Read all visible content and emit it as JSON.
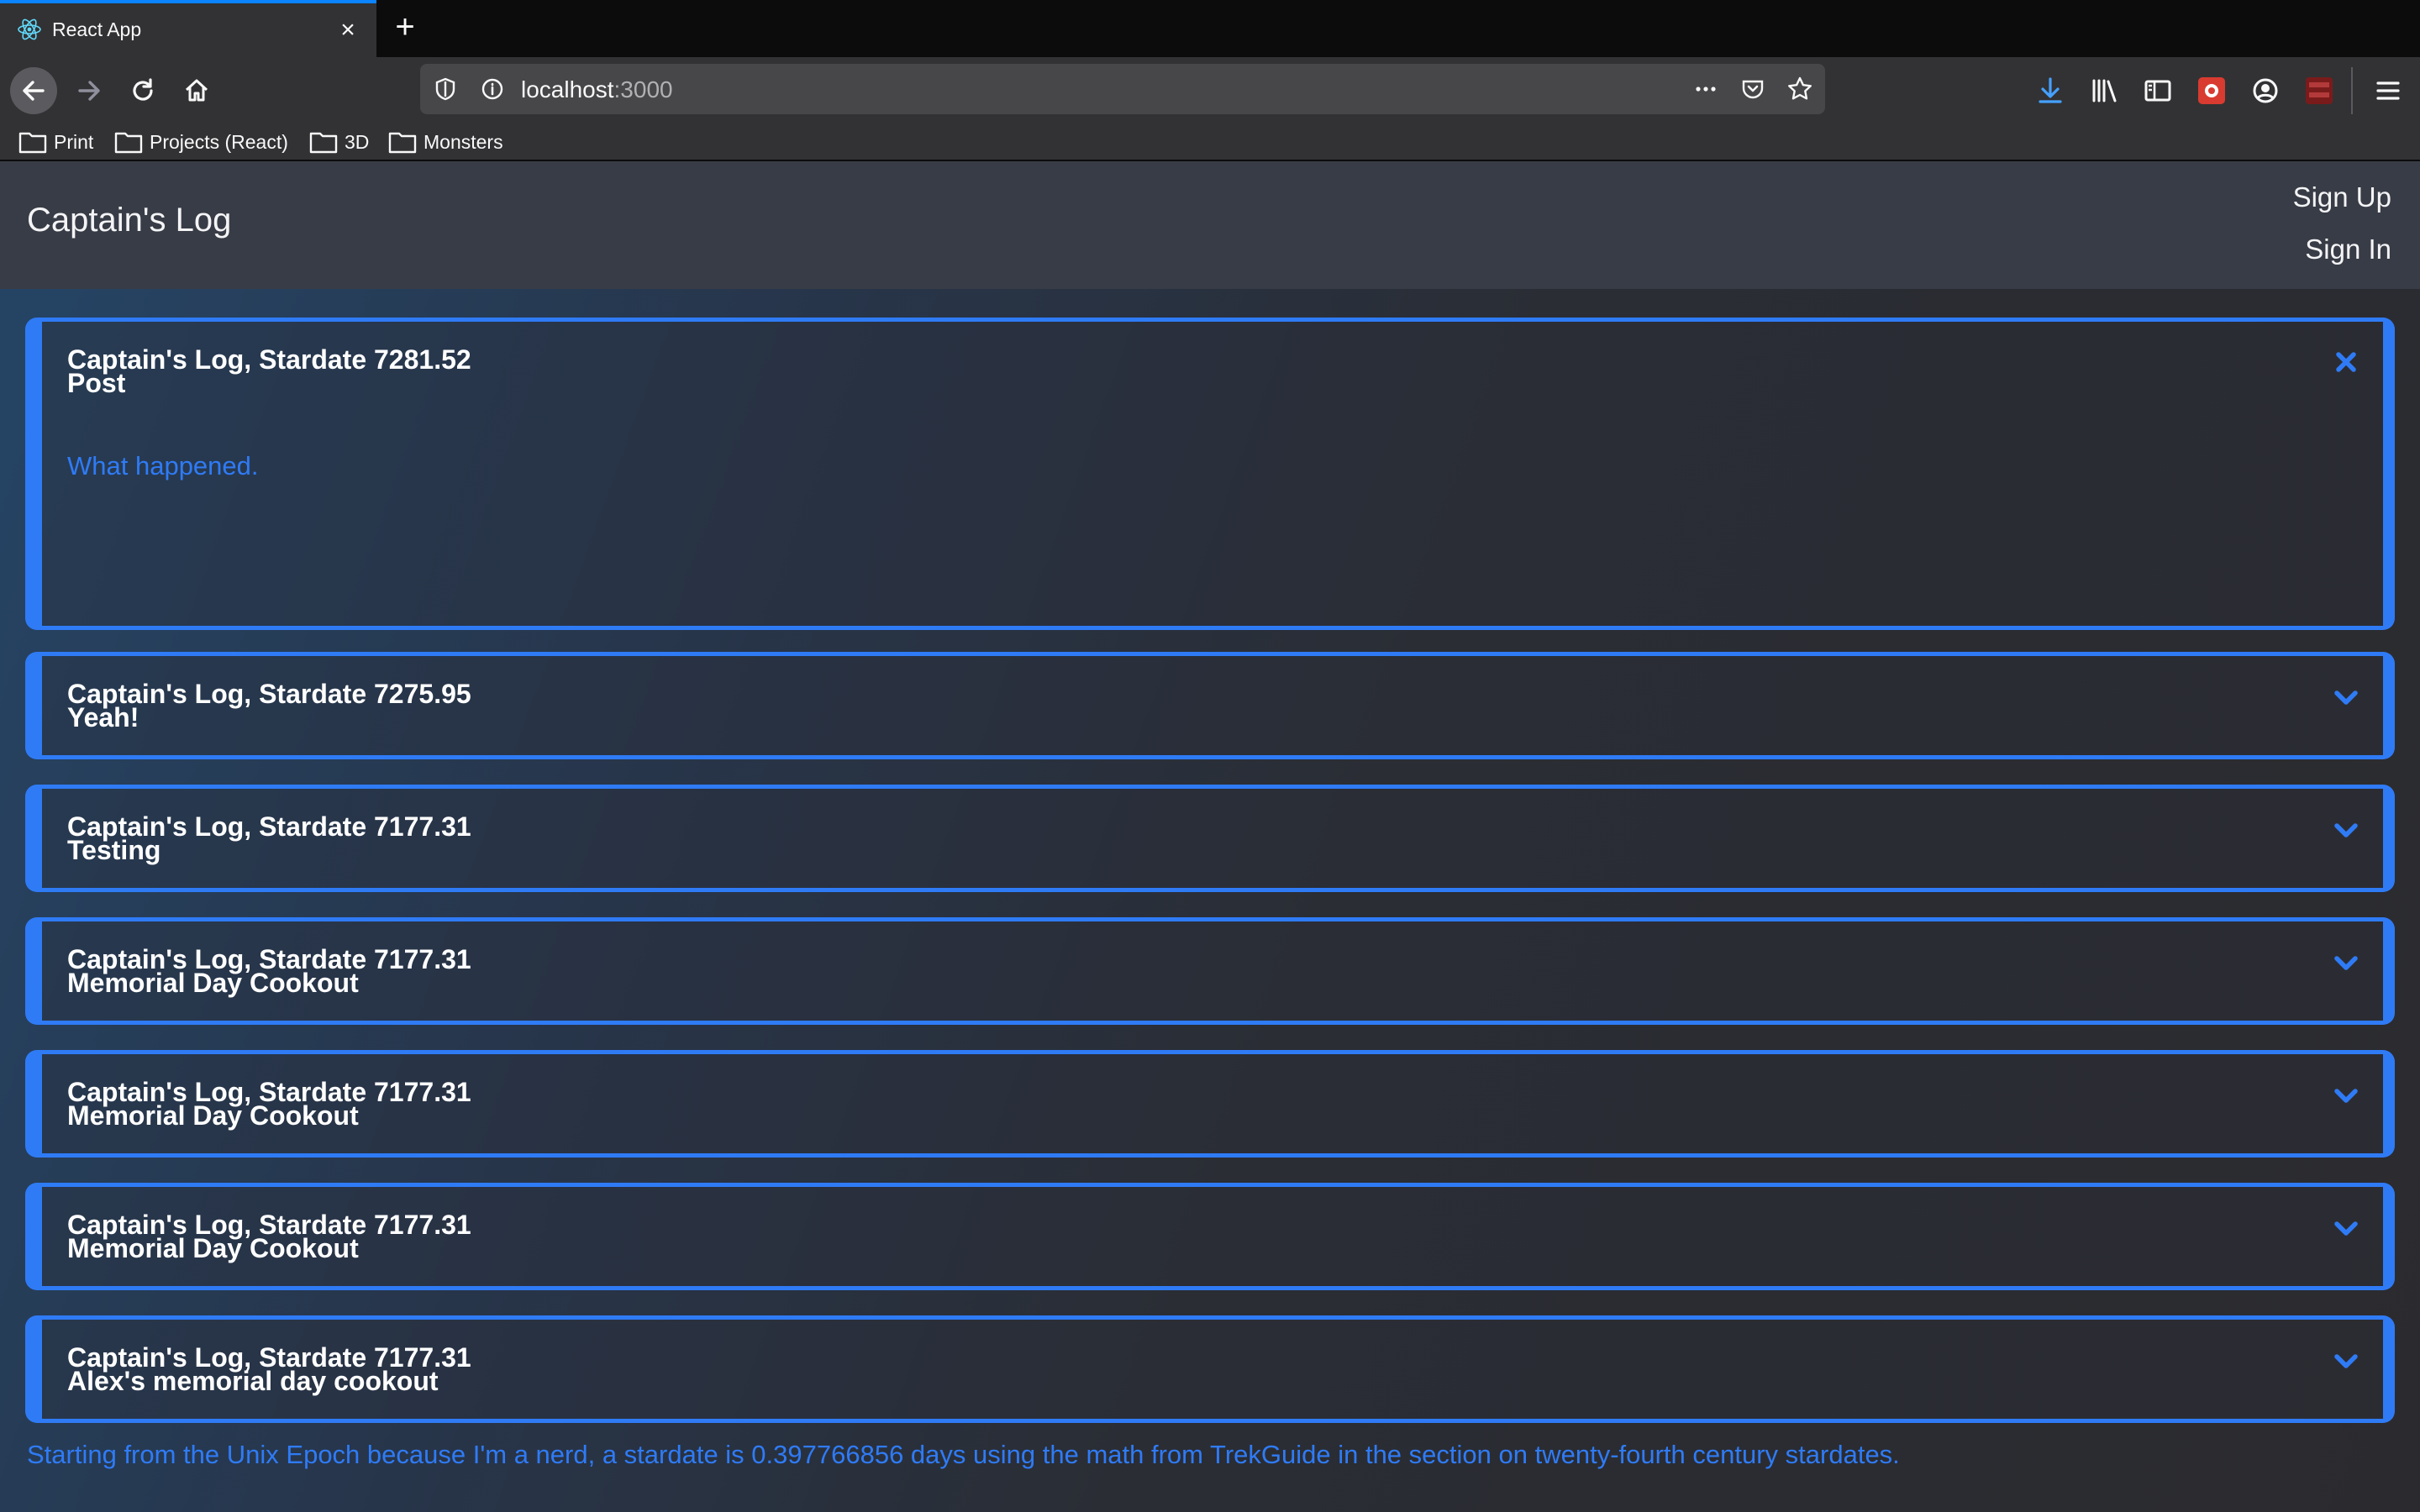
{
  "browser": {
    "tab_title": "React App",
    "url_host": "localhost",
    "url_port": ":3000",
    "bookmarks": [
      "Print",
      "Projects (React)",
      "3D",
      "Monsters"
    ]
  },
  "app": {
    "brand": "Captain's Log",
    "sign_up": "Sign Up",
    "sign_in": "Sign In"
  },
  "entries": [
    {
      "title": "Captain's Log, Stardate 7281.52",
      "subtitle": "Post",
      "body": "What happened.",
      "expanded": true,
      "action_icon": "close-icon"
    },
    {
      "title": "Captain's Log, Stardate 7275.95",
      "subtitle": "Yeah!",
      "expanded": false,
      "action_icon": "chevron-down-icon"
    },
    {
      "title": "Captain's Log, Stardate 7177.31",
      "subtitle": "Testing",
      "expanded": false,
      "action_icon": "chevron-down-icon"
    },
    {
      "title": "Captain's Log, Stardate 7177.31",
      "subtitle": "Memorial Day Cookout",
      "expanded": false,
      "action_icon": "chevron-down-icon"
    },
    {
      "title": "Captain's Log, Stardate 7177.31",
      "subtitle": "Memorial Day Cookout",
      "expanded": false,
      "action_icon": "chevron-down-icon"
    },
    {
      "title": "Captain's Log, Stardate 7177.31",
      "subtitle": "Memorial Day Cookout",
      "expanded": false,
      "action_icon": "chevron-down-icon"
    },
    {
      "title": "Captain's Log, Stardate 7177.31",
      "subtitle": "Alex's memorial day cookout",
      "expanded": false,
      "action_icon": "chevron-down-icon"
    }
  ],
  "footer_note": "Starting from the Unix Epoch because I'm a nerd, a stardate is 0.397766856 days using the math from TrekGuide in the section on twenty-fourth century stardates.",
  "colors": {
    "accent": "#2f7bf6",
    "header_bg": "#383c46",
    "browser_accent": "#0a84ff"
  }
}
